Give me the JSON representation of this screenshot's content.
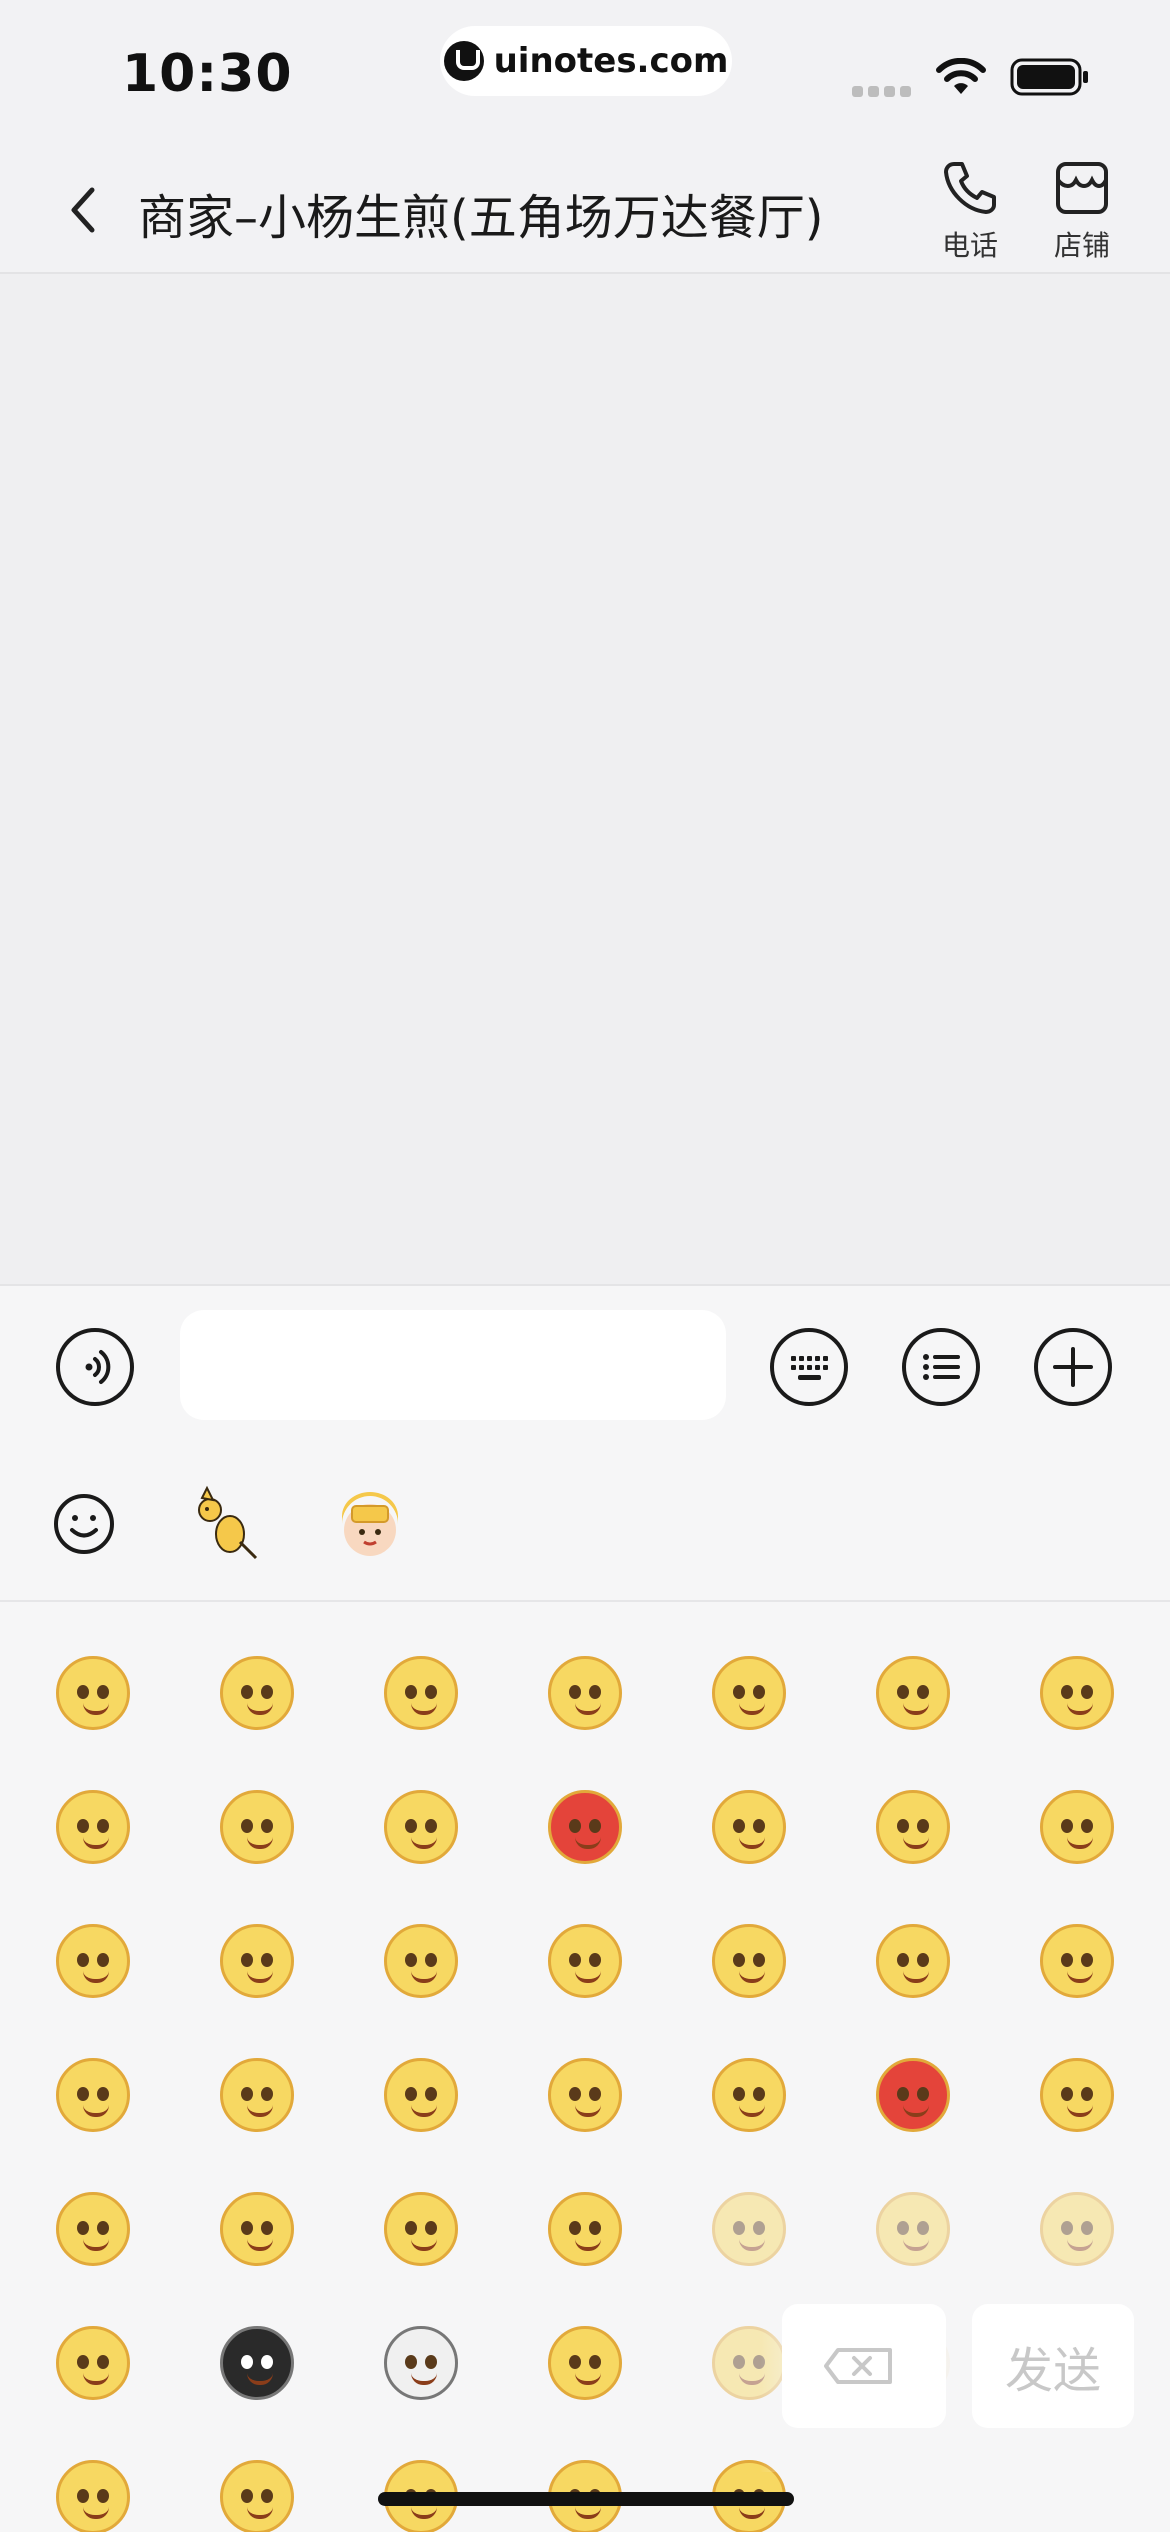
{
  "status_bar": {
    "time": "10:30",
    "watermark": "uinotes.com"
  },
  "nav": {
    "title": "商家–小杨生煎(五角场万达餐厅)",
    "phone_label": "电话",
    "store_label": "店铺"
  },
  "input": {
    "value": "",
    "placeholder": ""
  },
  "emoji_tabs": [
    "smiley-icon",
    "kangaroo-sticker-icon",
    "rider-sticker-icon"
  ],
  "actions": {
    "send_label": "发送"
  },
  "colors": {
    "accent_face": "#f7d862",
    "face_outline": "#e2a93a",
    "angry_red": "#e4443a"
  }
}
